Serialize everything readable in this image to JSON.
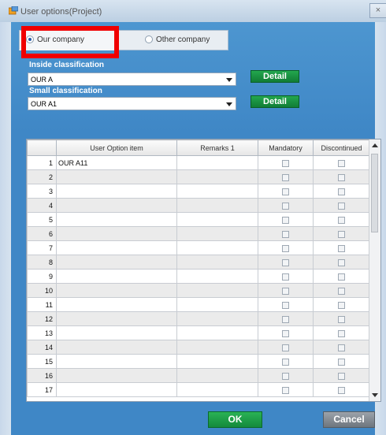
{
  "window": {
    "title": "User options(Project)",
    "close_glyph": "×"
  },
  "tabs": [
    {
      "label": "Our company",
      "selected": true
    },
    {
      "label": "Other company",
      "selected": false
    }
  ],
  "filters": {
    "inside_label": "Inside classification",
    "inside_value": "OUR A",
    "small_label": "Small classification",
    "small_value": "OUR A1",
    "detail_label": "Detail"
  },
  "table": {
    "columns": [
      "",
      "User Option item",
      "Remarks 1",
      "Mandatory",
      "Discontinued"
    ],
    "rows": [
      {
        "num": "1",
        "item": "OUR A11"
      },
      {
        "num": "2",
        "item": ""
      },
      {
        "num": "3",
        "item": ""
      },
      {
        "num": "4",
        "item": ""
      },
      {
        "num": "5",
        "item": ""
      },
      {
        "num": "6",
        "item": ""
      },
      {
        "num": "7",
        "item": ""
      },
      {
        "num": "8",
        "item": ""
      },
      {
        "num": "9",
        "item": ""
      },
      {
        "num": "10",
        "item": ""
      },
      {
        "num": "11",
        "item": ""
      },
      {
        "num": "12",
        "item": ""
      },
      {
        "num": "13",
        "item": ""
      },
      {
        "num": "14",
        "item": ""
      },
      {
        "num": "15",
        "item": ""
      },
      {
        "num": "16",
        "item": ""
      },
      {
        "num": "17",
        "item": ""
      }
    ]
  },
  "buttons": {
    "ok": "OK",
    "cancel": "Cancel"
  },
  "colors": {
    "panel": "#3f87c6",
    "highlight": "#f00000",
    "button_green": "#148a3c"
  },
  "icons": {
    "title": "app-window-icon",
    "close": "close-icon"
  }
}
